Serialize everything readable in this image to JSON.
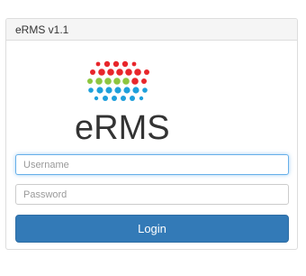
{
  "panel": {
    "title": "eRMS v1.1"
  },
  "logo": {
    "text": "eRMS",
    "dot_colors": [
      "#e8262b",
      "#8dc63f",
      "#1ea0db"
    ]
  },
  "form": {
    "username_placeholder": "Username",
    "password_placeholder": "Password",
    "login_label": "Login"
  },
  "colors": {
    "primary": "#337ab7",
    "focus": "#66afe9"
  }
}
